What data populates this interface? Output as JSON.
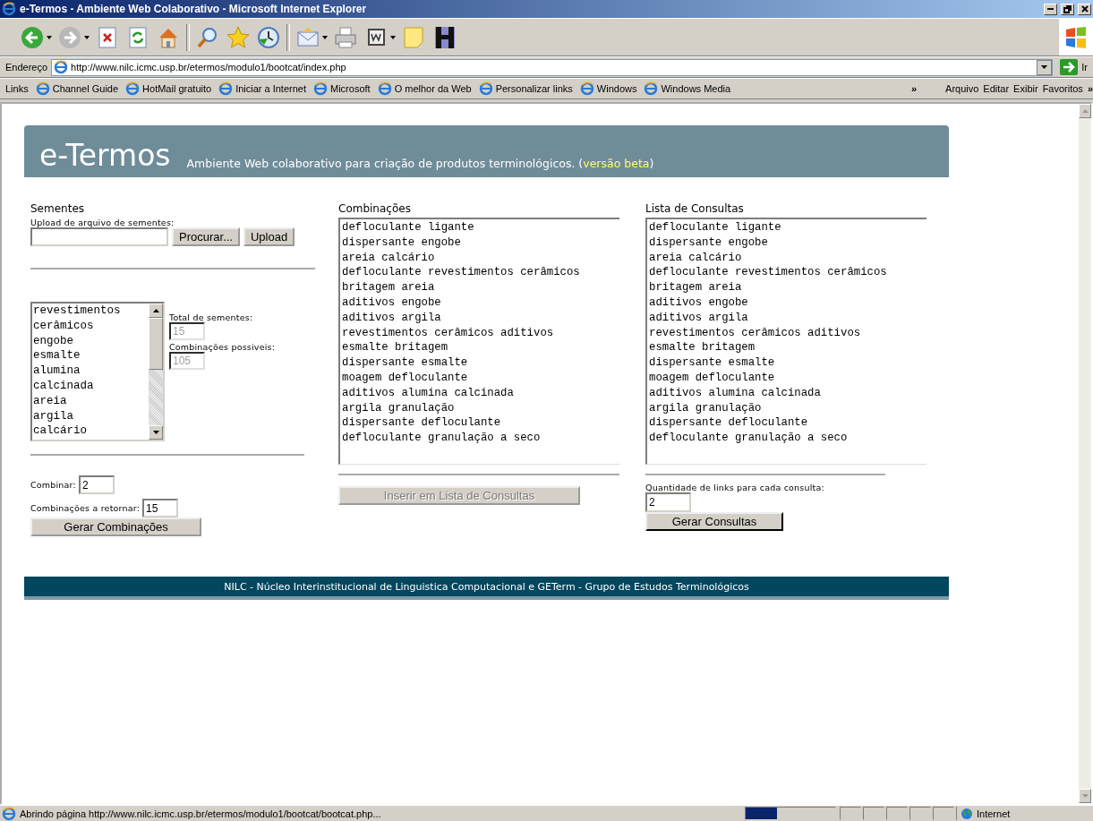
{
  "window": {
    "title": "e-Termos - Ambiente Web Colaborativo - Microsoft Internet Explorer"
  },
  "toolbar": {
    "buttons": [
      {
        "kind": "back",
        "has_menu": true
      },
      {
        "kind": "forward",
        "has_menu": true
      },
      {
        "kind": "stop",
        "has_menu": false
      },
      {
        "kind": "refresh",
        "has_menu": false
      },
      {
        "kind": "home",
        "has_menu": false
      },
      {
        "kind": "search",
        "has_menu": false
      },
      {
        "kind": "favorites",
        "has_menu": false
      },
      {
        "kind": "history",
        "has_menu": false
      },
      {
        "kind": "mail",
        "has_menu": true
      },
      {
        "kind": "print",
        "has_menu": false
      },
      {
        "kind": "edit",
        "has_menu": true
      },
      {
        "kind": "note",
        "has_menu": false
      },
      {
        "kind": "h",
        "has_menu": false
      }
    ]
  },
  "address_bar": {
    "label": "Endereço",
    "url": "http://www.nilc.icmc.usp.br/etermos/modulo1/bootcat/index.php",
    "go_label": "Ir"
  },
  "links_bar": {
    "label": "Links",
    "items": [
      "Channel Guide",
      "HotMail gratuito",
      "Iniciar a Internet",
      "Microsoft",
      "O melhor da Web",
      "Personalizar links",
      "Windows",
      "Windows Media"
    ],
    "more": "»"
  },
  "menu": {
    "items": [
      "Arquivo",
      "Editar",
      "Exibir",
      "Favoritos"
    ],
    "more": "»"
  },
  "header": {
    "logo": "e-Termos",
    "subtitle": "Ambiente Web colaborativo para criação de produtos terminológicos. (",
    "link": "versão beta",
    "subtitle_end": ")"
  },
  "seeds": {
    "title": "Sementes",
    "upload_label": "Upload de arquivo de sementes:",
    "browse_button": "Procurar...",
    "upload_button": "Upload",
    "list": [
      "revestimentos",
      "cerâmicos",
      "engobe",
      "esmalte",
      "alumina",
      "calcinada",
      "areia",
      "argila",
      "calcário"
    ],
    "total_label": "Total de sementes:",
    "total_value": "15",
    "total_disabled": true,
    "possible_label": "Combinações possiveis:",
    "possible_value": "105",
    "possible_disabled": true,
    "combine_label": "Combinar:",
    "combine_value": "2",
    "return_label": "Combinações a retornar:",
    "return_value": "15",
    "generate_button": "Gerar Combinações"
  },
  "combinations": {
    "title": "Combinações",
    "lines": [
      "defloculante ligante",
      "dispersante engobe",
      "areia calcário",
      "defloculante revestimentos cerâmicos",
      "britagem areia",
      "aditivos engobe",
      "aditivos argila",
      "revestimentos cerâmicos aditivos",
      "esmalte britagem",
      "dispersante esmalte",
      "moagem defloculante",
      "aditivos alumina calcinada",
      "argila granulação",
      "dispersante defloculante",
      "defloculante granulação a seco"
    ],
    "insert_button": {
      "label": "Inserir em Lista de Consultas",
      "disabled": true
    }
  },
  "queries": {
    "title": "Lista de Consultas",
    "lines": [
      "defloculante ligante",
      "dispersante engobe",
      "areia calcário",
      "defloculante revestimentos cerâmicos",
      "britagem areia",
      "aditivos engobe",
      "aditivos argila",
      "revestimentos cerâmicos aditivos",
      "esmalte britagem",
      "dispersante esmalte",
      "moagem defloculante",
      "aditivos alumina calcinada",
      "argila granulação",
      "dispersante defloculante",
      "defloculante granulação a seco"
    ],
    "links_label": "Quantidade de links para cada consulta:",
    "links_value": "2",
    "generate_button": {
      "label": "Gerar Consultas",
      "disabled": false
    }
  },
  "footer": {
    "text": "NILC - Núcleo Interinstitucional de Linguistica Computacional e GETerm - Grupo de Estudos Terminológicos"
  },
  "status_bar": {
    "text": "Abrindo página http://www.nilc.icmc.usp.br/etermos/modulo1/bootcat/bootcat.php...",
    "progress": {
      "level": 0.35
    },
    "zone": "Internet"
  }
}
